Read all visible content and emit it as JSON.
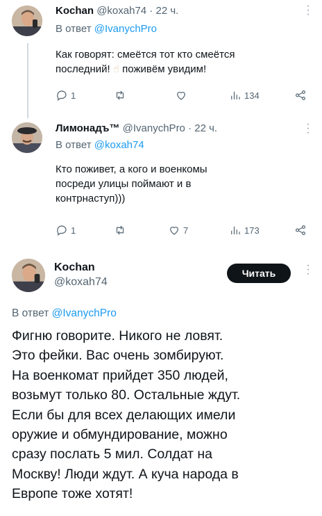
{
  "tweets": [
    {
      "name": "Kochan",
      "handle": "@koxah74",
      "sep": " · ",
      "time": "22 ч.",
      "reply_prefix": "В ответ ",
      "reply_handle": "@IvanychPro",
      "text_line1": "Как говорят: смеётся тот кто смеётся",
      "text_line2_a": "последний! ",
      "emoji": "☝",
      "text_line2_b": " поживём увидим!",
      "replies": "1",
      "retweets": "",
      "likes": "",
      "views": "134"
    },
    {
      "name": "Лимонадъ™",
      "handle": "@IvanychPro",
      "sep": " · ",
      "time": "22 ч.",
      "reply_prefix": "В ответ ",
      "reply_handle": "@koxah74",
      "text_lines": [
        "Кто поживет, а кого и военкомы",
        "посреди улицы поймают и в",
        "контрнаступ)))"
      ],
      "replies": "1",
      "retweets": "",
      "likes": "7",
      "views": "173"
    }
  ],
  "main_tweet": {
    "name": "Kochan",
    "handle": "@koxah74",
    "follow_label": "Читать",
    "reply_prefix": "В ответ ",
    "reply_handle": "@IvanychPro",
    "text_lines": [
      "Фигню говорите. Никого не ловят.",
      "Это фейки. Вас очень зомбируют.",
      "На военкомат прийдет 350 людей,",
      "возьмут только 80. Остальные ждут.",
      "Если бы для всех делающих имели",
      "оружие и обмундирование, можно",
      "сразу послать 5 мил. Солдат на",
      "Москву! Люди ждут. А куча народа в",
      "Европе тоже хотят!"
    ]
  },
  "icons": {
    "reply": "reply-icon",
    "retweet": "retweet-icon",
    "like": "heart-icon",
    "views": "views-icon",
    "share": "share-icon",
    "more": "more-dots-icon"
  },
  "colors": {
    "text": "#0f1419",
    "secondary": "#536471",
    "link": "#1d9bf0",
    "thread_line": "#cfd9de",
    "button_bg": "#0f1419"
  }
}
